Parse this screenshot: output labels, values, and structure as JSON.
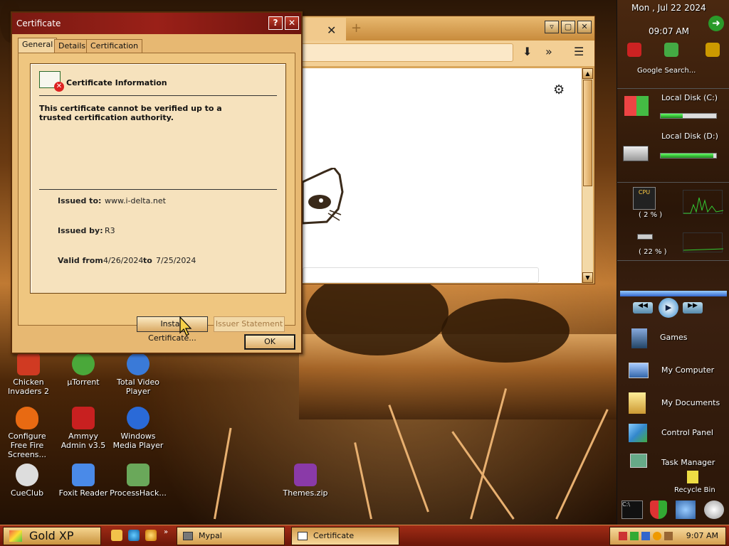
{
  "desktop": {
    "icons": [
      {
        "label": "Chicken Invaders 2",
        "icon": "chicken-invaders-icon",
        "color": "#d03a22"
      },
      {
        "label": "μTorrent",
        "icon": "utorrent-icon",
        "color": "#4aa83a"
      },
      {
        "label": "Total Video Player",
        "icon": "total-video-player-icon",
        "color": "#3a7ad8"
      },
      {
        "label": "Configure Free Fire Screens...",
        "icon": "fire-icon",
        "color": "#e86a12"
      },
      {
        "label": "Ammyy Admin v3.5",
        "icon": "ammyy-admin-icon",
        "color": "#c82020"
      },
      {
        "label": "Windows Media Player",
        "icon": "windows-media-player-icon",
        "color": "#2a6ad8"
      },
      {
        "label": "CueClub",
        "icon": "cueclub-icon",
        "color": "#dddddd"
      },
      {
        "label": "Foxit Reader",
        "icon": "foxit-reader-icon",
        "color": "#4a8ae8"
      },
      {
        "label": "ProcessHack...",
        "icon": "processhacker-icon",
        "color": "#6aa85a"
      },
      {
        "label": "Themes.zip",
        "icon": "winrar-archive-icon",
        "color": "#8a3aa8"
      }
    ]
  },
  "browser": {
    "tab_close": "✕",
    "new_tab": "+",
    "download_icon": "⬇",
    "overflow_icon": "»",
    "menu_icon": "☰",
    "gear_icon": "⚙",
    "win_min": "▿",
    "win_max": "▢",
    "win_close": "✕"
  },
  "dialog": {
    "title": "Certificate",
    "help": "?",
    "close": "✕",
    "tabs": [
      "General",
      "Details",
      "Certification Path"
    ],
    "heading": "Certificate Information",
    "warning": "This certificate cannot be verified up to a trusted certification authority.",
    "issued_to_label": "Issued to:",
    "issued_to_value": "www.i-delta.net",
    "issued_by_label": "Issued by:",
    "issued_by_value": "R3",
    "valid_from_label": "Valid from",
    "valid_from_value": "4/26/2024",
    "valid_to_label": "to",
    "valid_to_value": "7/25/2024",
    "install_button": "Install Certificate...",
    "issuer_button": "Issuer Statement",
    "ok_button": "OK"
  },
  "sidebar": {
    "date": "Mon , Jul 22 2024",
    "time": "09:07 AM",
    "search_placeholder": "Google Search...",
    "disk_c_label": "Local Disk (C:)",
    "disk_c_usage": 0.4,
    "disk_d_label": "Local Disk (D:)",
    "disk_d_usage": 0.95,
    "cpu_label": "CPU",
    "cpu_value": "( 2 % )",
    "ram_value": "( 22 % )",
    "links": [
      "Games",
      "My Computer",
      "My Documents",
      "Control Panel",
      "Task Manager",
      "Recycle Bin"
    ]
  },
  "taskbar": {
    "start_label": "Gold XP",
    "tasks": [
      "Mypal",
      "Certificate"
    ],
    "clock": "9:07 AM",
    "chevron": "»"
  }
}
